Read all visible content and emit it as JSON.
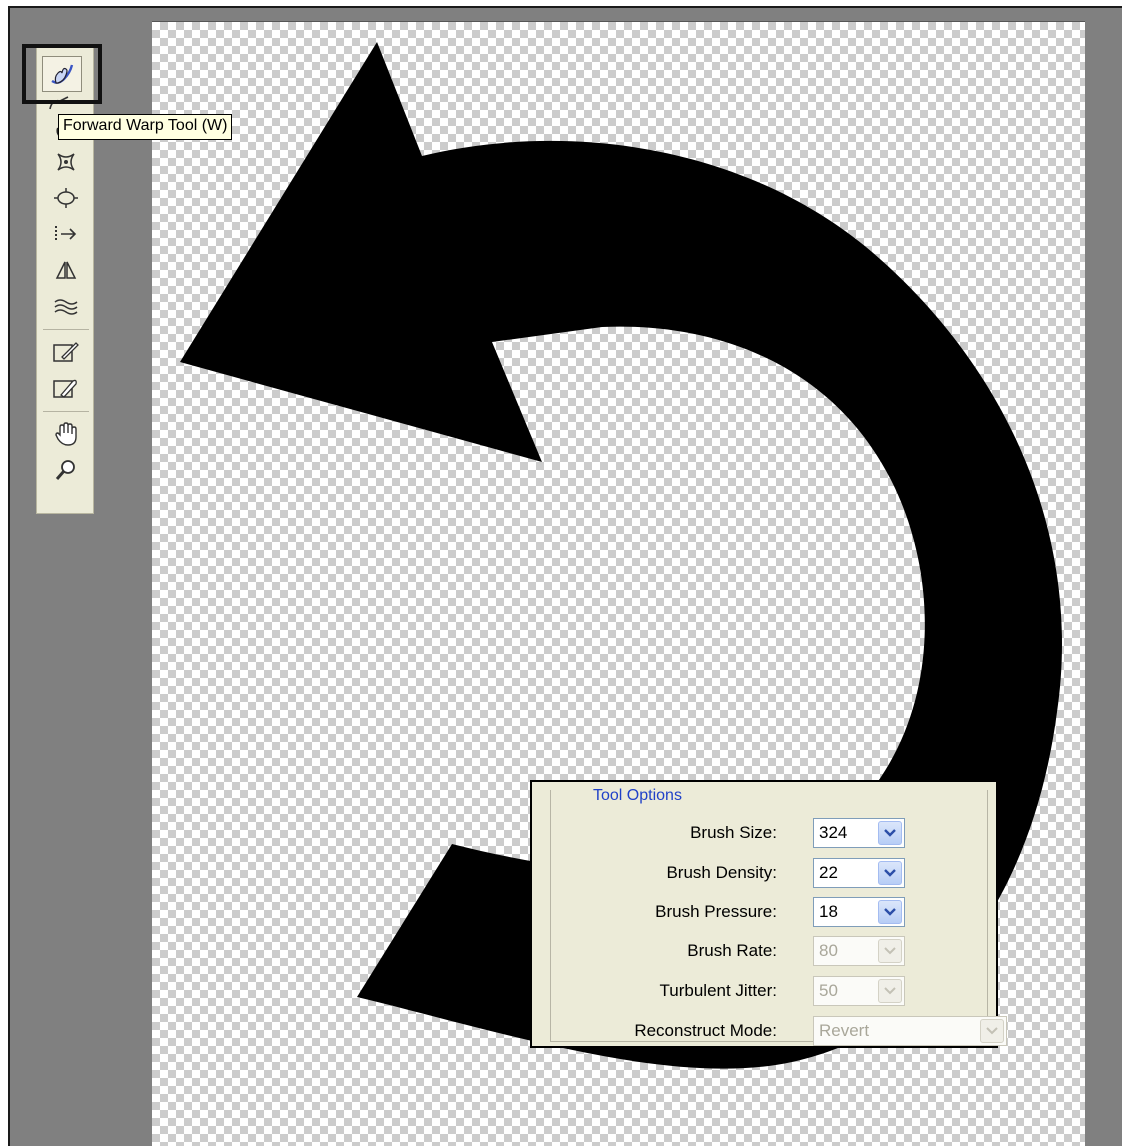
{
  "tooltip": {
    "text": "Forward Warp Tool (W)"
  },
  "toolbar": {
    "active_tool": "forward-warp-tool",
    "tools": [
      {
        "name": "forward-warp-tool",
        "icon": "warp-finger-icon"
      },
      {
        "name": "reconstruct-tool",
        "icon": "reconstruct-brush-icon"
      },
      {
        "name": "twirl-clockwise-tool",
        "icon": "twirl-icon"
      },
      {
        "name": "pucker-tool",
        "icon": "pucker-icon"
      },
      {
        "name": "bloat-tool",
        "icon": "bloat-icon"
      },
      {
        "name": "push-left-tool",
        "icon": "push-left-icon"
      },
      {
        "name": "mirror-tool",
        "icon": "mirror-icon"
      },
      {
        "name": "turbulence-tool",
        "icon": "turbulence-icon"
      },
      {
        "name": "freeze-mask-tool",
        "icon": "freeze-mask-icon"
      },
      {
        "name": "thaw-mask-tool",
        "icon": "thaw-mask-icon"
      },
      {
        "name": "hand-tool",
        "icon": "hand-icon"
      },
      {
        "name": "zoom-tool",
        "icon": "zoom-icon"
      }
    ]
  },
  "tool_options": {
    "legend": "Tool Options",
    "fields": {
      "brush_size": {
        "label": "Brush Size:",
        "value": "324"
      },
      "brush_density": {
        "label": "Brush Density:",
        "value": "22"
      },
      "brush_pressure": {
        "label": "Brush Pressure:",
        "value": "18"
      },
      "brush_rate": {
        "label": "Brush Rate:",
        "value": "80"
      },
      "turbulent_jitter": {
        "label": "Turbulent Jitter:",
        "value": "50"
      },
      "reconstruct_mode": {
        "label": "Reconstruct Mode:",
        "value": "Revert"
      }
    }
  },
  "colors": {
    "panel_bg": "#ecebd8",
    "workspace_bg": "#808080",
    "legend_text": "#2041c8",
    "shape_fill": "#000000"
  }
}
